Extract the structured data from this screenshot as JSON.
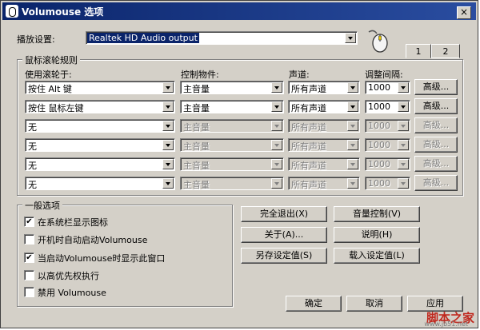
{
  "window": {
    "title": "Volumouse 选项",
    "close_glyph": "×"
  },
  "playback": {
    "label": "播放设置:",
    "device": "Realtek HD Audio output"
  },
  "tabs": [
    "1",
    "2"
  ],
  "rules": {
    "group_title": "鼠标滚轮规则",
    "headers": {
      "use_wheel": "使用滚轮于:",
      "component": "控制物件:",
      "channel": "声道:",
      "interval": "调整间隔:"
    },
    "advanced_label": "高级...",
    "rows": [
      {
        "condition": "按住 Alt 键",
        "component": "主音量",
        "channel": "所有声道",
        "interval": "1000",
        "enabled": true
      },
      {
        "condition": "按住 鼠标左键",
        "component": "主音量",
        "channel": "所有声道",
        "interval": "1000",
        "enabled": true
      },
      {
        "condition": "无",
        "component": "主音量",
        "channel": "所有声道",
        "interval": "1000",
        "enabled": false
      },
      {
        "condition": "无",
        "component": "主音量",
        "channel": "所有声道",
        "interval": "1000",
        "enabled": false
      },
      {
        "condition": "无",
        "component": "主音量",
        "channel": "所有声道",
        "interval": "1000",
        "enabled": false
      },
      {
        "condition": "无",
        "component": "主音量",
        "channel": "所有声道",
        "interval": "1000",
        "enabled": false
      }
    ]
  },
  "general": {
    "group_title": "一般选项",
    "options": [
      {
        "label": "在系统栏显示图标",
        "checked": true
      },
      {
        "label": "开机时自动启动Volumouse",
        "checked": false
      },
      {
        "label": "当启动Volumouse时显示此窗口",
        "checked": true
      },
      {
        "label": "以高优先权执行",
        "checked": false
      },
      {
        "label": "禁用 Volumouse",
        "checked": false
      }
    ]
  },
  "buttons": {
    "exit": "完全退出(X)",
    "volume_control": "音量控制(V)",
    "about": "关于(A)...",
    "help": "说明(H)",
    "save_settings": "另存设定值(S)",
    "load_settings": "载入设定值(L)",
    "ok": "确定",
    "cancel": "取消",
    "apply": "应用"
  },
  "watermark": {
    "text": "脚本之家",
    "url": "www.jb51.net"
  }
}
